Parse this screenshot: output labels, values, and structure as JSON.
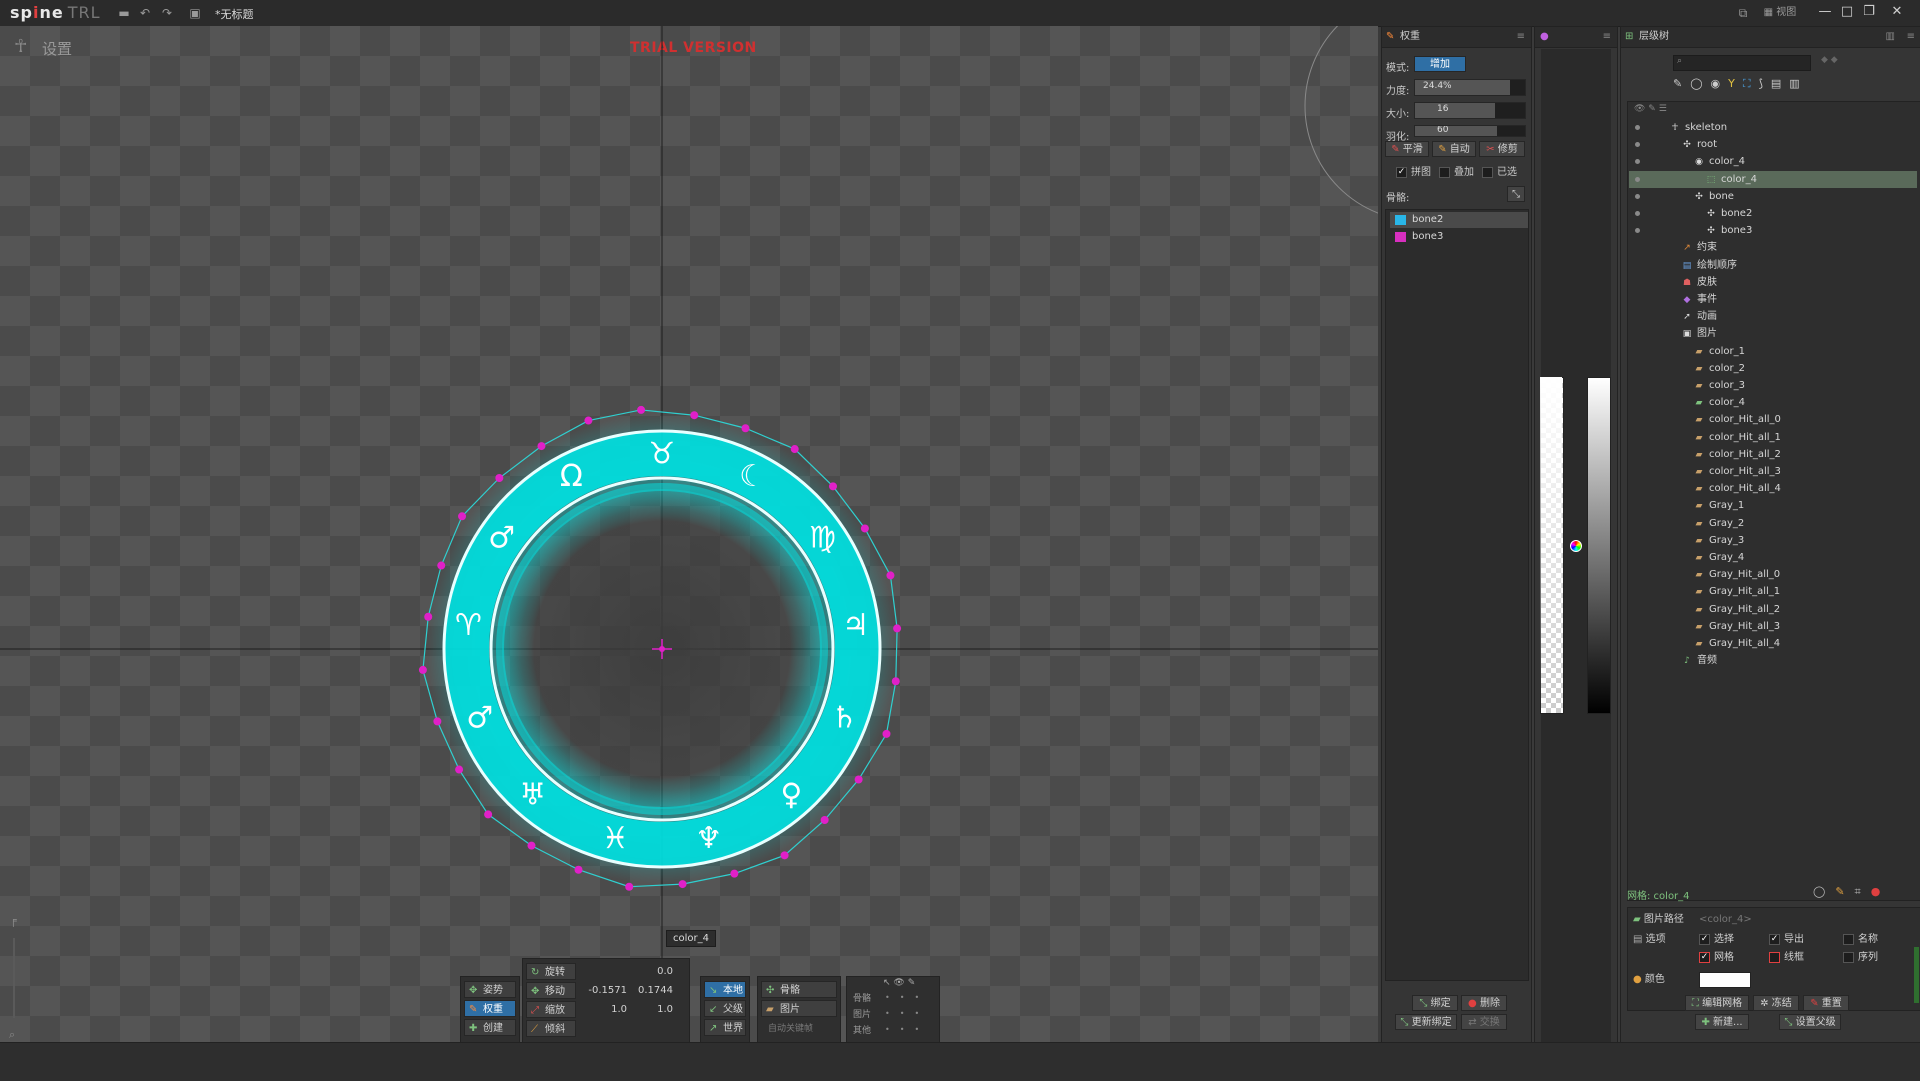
{
  "app": {
    "logo_main": "sp",
    "logo_dot": "i",
    "logo_tail": "ne",
    "logo_suffix": "TRL",
    "doc_title": "*无标题"
  },
  "viewport": {
    "settings_label": "设置",
    "trial_text": "TRIAL VERSION",
    "selected_slot_tag": "color_4"
  },
  "transform_bar": {
    "mode_buttons": [
      "姿势",
      "权重",
      "创建"
    ],
    "rows": [
      {
        "label": "旋转",
        "v1": "",
        "v2": "0.0"
      },
      {
        "label": "移动",
        "v1": "-0.1571",
        "v2": "0.1744"
      },
      {
        "label": "缩放",
        "v1": "1.0",
        "v2": "1.0"
      },
      {
        "label": "倾斜",
        "v1": "",
        "v2": ""
      }
    ],
    "axes": [
      "本地",
      "父级",
      "世界"
    ],
    "compensate": [
      "骨骼",
      "图片"
    ],
    "auto_key": "自动关键帧",
    "vis_labels": [
      "骨骼",
      "图片",
      "其他"
    ]
  },
  "weights_panel": {
    "title": "权重",
    "mode_label": "模式:",
    "mode_value": "增加",
    "strength_label": "力度:",
    "strength_value": "24.4%",
    "size_label": "大小:",
    "size_value": "16",
    "feather_label": "羽化:",
    "feather_value": "60",
    "buttons": [
      "平滑",
      "自动",
      "修剪"
    ],
    "checks": [
      {
        "label": "拼图",
        "checked": true
      },
      {
        "label": "叠加",
        "checked": false
      },
      {
        "label": "已选",
        "checked": false
      }
    ],
    "bones_label": "骨骼:",
    "bones": [
      {
        "name": "bone2",
        "color": "#29b6e8"
      },
      {
        "name": "bone3",
        "color": "#d82fbf"
      }
    ],
    "bottom_buttons": [
      "绑定",
      "删除",
      "更新绑定",
      "交换"
    ]
  },
  "tree_panel": {
    "title": "层级树",
    "search_placeholder": "",
    "items": [
      {
        "label": "skeleton",
        "depth": 0,
        "icon": "skeleton-icon",
        "glyph": "☥",
        "color": "#dcdcdc"
      },
      {
        "label": "root",
        "depth": 1,
        "icon": "bone-icon",
        "glyph": "✣",
        "color": "#dcdcdc"
      },
      {
        "label": "color_4",
        "depth": 2,
        "icon": "slot-icon",
        "glyph": "◉",
        "color": "#dcdcdc"
      },
      {
        "label": "color_4",
        "depth": 3,
        "icon": "mesh-icon",
        "glyph": "⬚",
        "color": "#7ec27e",
        "selected": true
      },
      {
        "label": "bone",
        "depth": 2,
        "icon": "bone-icon",
        "glyph": "✣",
        "color": "#dcdcdc"
      },
      {
        "label": "bone2",
        "depth": 3,
        "icon": "bone-icon",
        "glyph": "✣",
        "color": "#dcdcdc"
      },
      {
        "label": "bone3",
        "depth": 3,
        "icon": "bone-icon",
        "glyph": "✣",
        "color": "#dcdcdc"
      },
      {
        "label": "约束",
        "depth": 1,
        "icon": "constraint-icon",
        "glyph": "↗",
        "color": "#e08a3a"
      },
      {
        "label": "绘制顺序",
        "depth": 1,
        "icon": "draw-order-icon",
        "glyph": "▤",
        "color": "#6aa0e0"
      },
      {
        "label": "皮肤",
        "depth": 1,
        "icon": "skin-icon",
        "glyph": "☗",
        "color": "#e06060"
      },
      {
        "label": "事件",
        "depth": 1,
        "icon": "event-icon",
        "glyph": "◆",
        "color": "#b070e0"
      },
      {
        "label": "动画",
        "depth": 1,
        "icon": "animation-icon",
        "glyph": "➚",
        "color": "#dcdcdc"
      },
      {
        "label": "图片",
        "depth": 1,
        "icon": "images-folder-icon",
        "glyph": "▣",
        "color": "#dcdcdc"
      },
      {
        "label": "color_1",
        "depth": 2,
        "icon": "image-icon",
        "glyph": "▰",
        "color": "#c8a06a"
      },
      {
        "label": "color_2",
        "depth": 2,
        "icon": "image-icon",
        "glyph": "▰",
        "color": "#c8a06a"
      },
      {
        "label": "color_3",
        "depth": 2,
        "icon": "image-icon",
        "glyph": "▰",
        "color": "#c8a06a"
      },
      {
        "label": "color_4",
        "depth": 2,
        "icon": "image-icon",
        "glyph": "▰",
        "color": "#7ec27e"
      },
      {
        "label": "color_Hit_all_0",
        "depth": 2,
        "icon": "image-icon",
        "glyph": "▰",
        "color": "#c8a06a"
      },
      {
        "label": "color_Hit_all_1",
        "depth": 2,
        "icon": "image-icon",
        "glyph": "▰",
        "color": "#c8a06a"
      },
      {
        "label": "color_Hit_all_2",
        "depth": 2,
        "icon": "image-icon",
        "glyph": "▰",
        "color": "#c8a06a"
      },
      {
        "label": "color_Hit_all_3",
        "depth": 2,
        "icon": "image-icon",
        "glyph": "▰",
        "color": "#c8a06a"
      },
      {
        "label": "color_Hit_all_4",
        "depth": 2,
        "icon": "image-icon",
        "glyph": "▰",
        "color": "#c8a06a"
      },
      {
        "label": "Gray_1",
        "depth": 2,
        "icon": "image-icon",
        "glyph": "▰",
        "color": "#c8a06a"
      },
      {
        "label": "Gray_2",
        "depth": 2,
        "icon": "image-icon",
        "glyph": "▰",
        "color": "#c8a06a"
      },
      {
        "label": "Gray_3",
        "depth": 2,
        "icon": "image-icon",
        "glyph": "▰",
        "color": "#c8a06a"
      },
      {
        "label": "Gray_4",
        "depth": 2,
        "icon": "image-icon",
        "glyph": "▰",
        "color": "#c8a06a"
      },
      {
        "label": "Gray_Hit_all_0",
        "depth": 2,
        "icon": "image-icon",
        "glyph": "▰",
        "color": "#c8a06a"
      },
      {
        "label": "Gray_Hit_all_1",
        "depth": 2,
        "icon": "image-icon",
        "glyph": "▰",
        "color": "#c8a06a"
      },
      {
        "label": "Gray_Hit_all_2",
        "depth": 2,
        "icon": "image-icon",
        "glyph": "▰",
        "color": "#c8a06a"
      },
      {
        "label": "Gray_Hit_all_3",
        "depth": 2,
        "icon": "image-icon",
        "glyph": "▰",
        "color": "#c8a06a"
      },
      {
        "label": "Gray_Hit_all_4",
        "depth": 2,
        "icon": "image-icon",
        "glyph": "▰",
        "color": "#c8a06a"
      },
      {
        "label": "音频",
        "depth": 1,
        "icon": "audio-icon",
        "glyph": "♪",
        "color": "#7ec27e"
      }
    ]
  },
  "mesh_props": {
    "title": "网格: color_4",
    "path_label": "图片路径",
    "path_placeholder": "<color_4>",
    "options_label": "选项",
    "opt_select": "选择",
    "opt_export": "导出",
    "opt_name": "名称",
    "opt_mesh": "网格",
    "opt_wire": "线框",
    "opt_sequence": "序列",
    "color_label": "颜色",
    "buttons": [
      "编辑网格",
      "冻结",
      "重置",
      "新建...",
      "设置父级"
    ]
  },
  "colors": {
    "accent": "#2f6fa5",
    "glow": "#00e5e5",
    "vertex": "#e020c8"
  }
}
